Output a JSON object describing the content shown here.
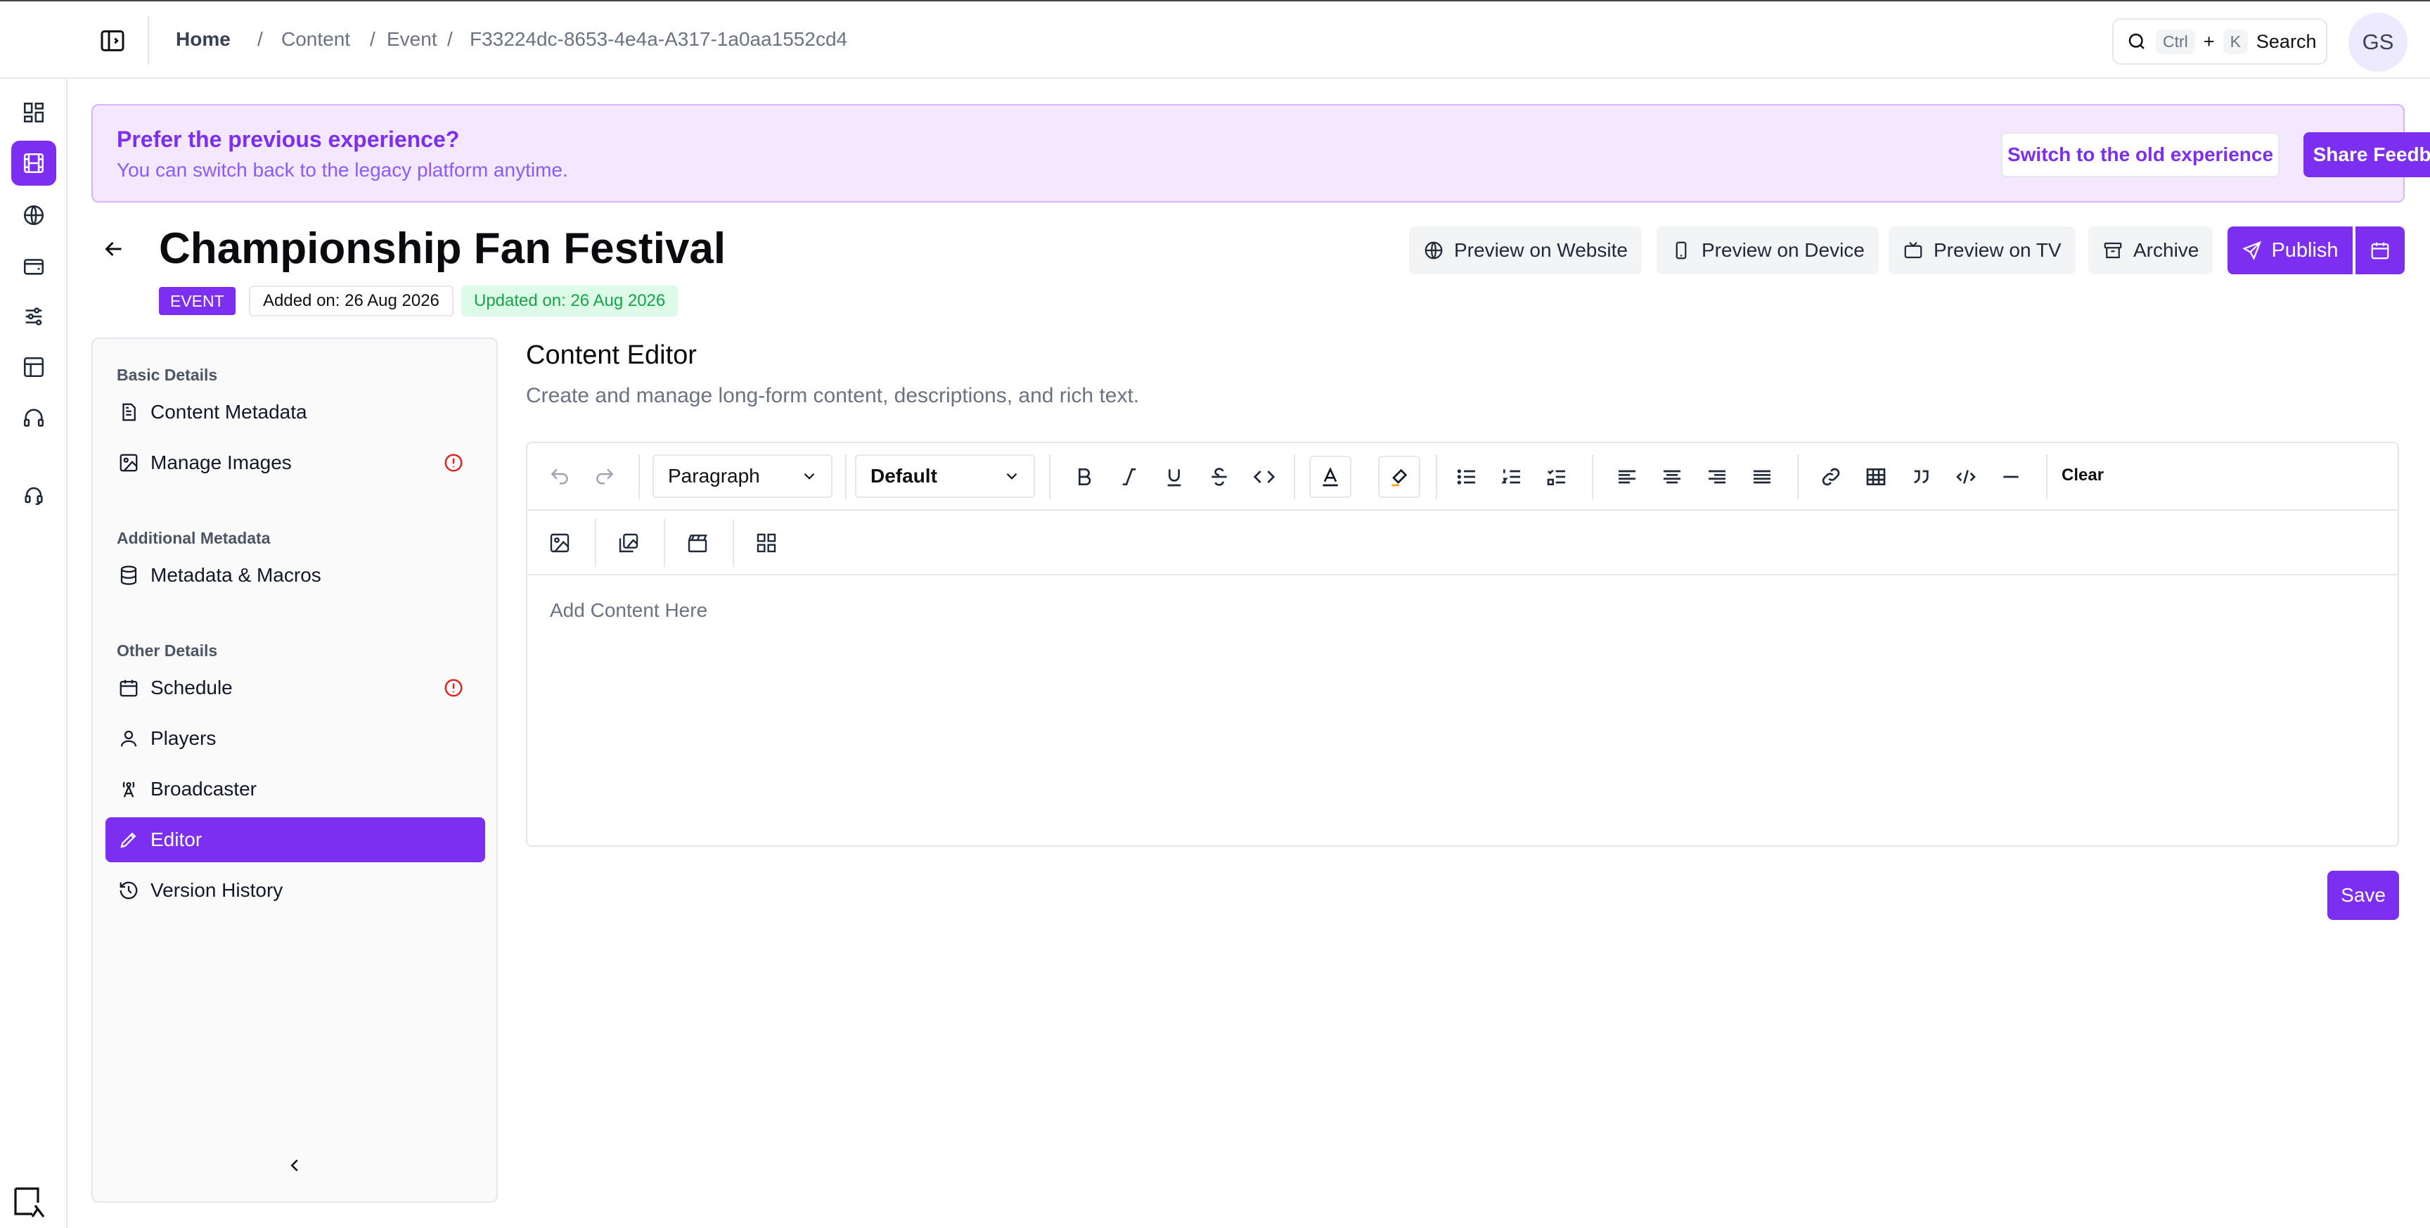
{
  "breadcrumb": {
    "home": "Home",
    "items": [
      "Content",
      "Event",
      "F33224dc-8653-4e4a-A317-1a0aa1552cd4"
    ],
    "separator": "/"
  },
  "search": {
    "kbd_ctrl": "Ctrl",
    "plus": "+",
    "kbd_k": "K",
    "label": "Search"
  },
  "user": {
    "initials": "GS"
  },
  "rail": {
    "items": [
      "dashboard-icon",
      "film-icon",
      "globe-icon",
      "wallet-icon",
      "sliders-icon",
      "layout-icon",
      "headphones-icon",
      "support-icon"
    ],
    "active_index": 1
  },
  "banner": {
    "title": "Prefer the previous experience?",
    "subtitle": "You can switch back to the legacy platform anytime.",
    "switch_label": "Switch to the old experience",
    "feedback_label": "Share Feedback"
  },
  "header": {
    "title": "Championship Fan Festival",
    "type_tag": "EVENT",
    "added": "Added on: 26 Aug 2026",
    "updated": "Updated on: 26 Aug 2026",
    "actions": {
      "preview_website": "Preview on Website",
      "preview_device": "Preview on Device",
      "preview_tv": "Preview on TV",
      "archive": "Archive",
      "publish": "Publish"
    }
  },
  "sidenav": {
    "groups": {
      "basic": "Basic Details",
      "additional": "Additional Metadata",
      "other": "Other Details"
    },
    "items": {
      "content_metadata": "Content Metadata",
      "manage_images": "Manage Images",
      "metadata_macros": "Metadata & Macros",
      "schedule": "Schedule",
      "players": "Players",
      "broadcaster": "Broadcaster",
      "editor": "Editor",
      "version_history": "Version History"
    },
    "active": "editor"
  },
  "editor": {
    "title": "Content Editor",
    "subtitle": "Create and manage long-form content, descriptions, and rich text.",
    "block_type": "Paragraph",
    "font": "Default",
    "clear_label": "Clear",
    "placeholder": "Add Content Here",
    "save_label": "Save"
  },
  "colors": {
    "accent": "#7c2ff0",
    "banner_bg": "#f3e8ff",
    "success": "#16a34a",
    "warning": "#dc2626"
  }
}
